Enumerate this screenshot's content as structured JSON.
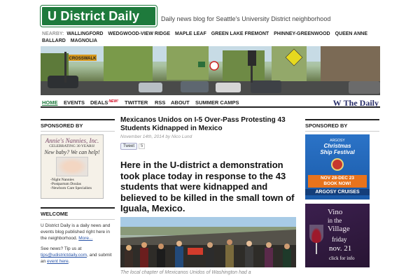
{
  "header": {
    "site_title": "U District Daily",
    "tagline": "Daily news blog for Seattle's University District neighborhood"
  },
  "nearby": {
    "label": "NEARBY:",
    "items": [
      "WALLINGFORD",
      "WEDGWOOD-VIEW RIDGE",
      "MAPLE LEAF",
      "GREEN LAKE FREMONT",
      "PHINNEY-GREENWOOD",
      "QUEEN ANNE",
      "BALLARD",
      "MAGNOLIA"
    ]
  },
  "hero": {
    "sign_text": "CROSSWALK"
  },
  "nav": {
    "items": [
      "HOME",
      "EVENTS",
      "DEALS",
      "TWITTER",
      "RSS",
      "ABOUT",
      "SUMMER CAMPS"
    ],
    "new_badge": "NEW!",
    "brand_w": "W",
    "brand_name": "The Daily"
  },
  "left_sidebar": {
    "sponsored_title": "SPONSORED BY",
    "ad": {
      "name": "Annie's Nannies, Inc.",
      "years": "CELEBRATING 30 YEARS!",
      "cta": "New baby? We can help!",
      "lines": [
        "-Night Nannies",
        "-Postpartum Doulas",
        "-Newborn Care Specialists"
      ]
    },
    "welcome_title": "WELCOME",
    "welcome_text": "U District Daily is a daily news and events blog published right here in the neighborhood.",
    "more_link": "More...",
    "tip_text_1": "See news? Tip us at",
    "tip_email": "tips@udistrictdaily.com",
    "tip_text_2": ", and submit an",
    "event_link": "event here",
    "tip_text_3": "."
  },
  "article": {
    "title": "Mexicanos Unidos on I-5 Over-Pass Protesting 43 Students Kidnapped in Mexico",
    "date_line": "November 14th, 2014 by Nico Lund",
    "tweet_label": "Tweet",
    "tweet_count": "5",
    "lead": "Here in the U-district a demonstration took place today in response to the 43 students that were kidnapped and believed to be killed in the small town of Iguala, Mexico.",
    "caption": "The local chapter of Mexicanos Unidos of Washington had a"
  },
  "right_sidebar": {
    "sponsored_title": "SPONSORED BY",
    "argosy": {
      "top": "ARGOSY",
      "title_1": "Christmas",
      "title_2": "Ship Festival",
      "dates": "NOV 28-DEC 23",
      "cta": "BOOK NOW!",
      "brand": "ARGOSY CRUISES"
    },
    "vino": {
      "title_1": "Vino",
      "title_2": "in the",
      "title_3": "Village",
      "day": "friday",
      "date": "nov. 21",
      "info": "click for info"
    }
  },
  "colors": {
    "brand_green": "#1e7a3c",
    "link_blue": "#2a55a8"
  }
}
